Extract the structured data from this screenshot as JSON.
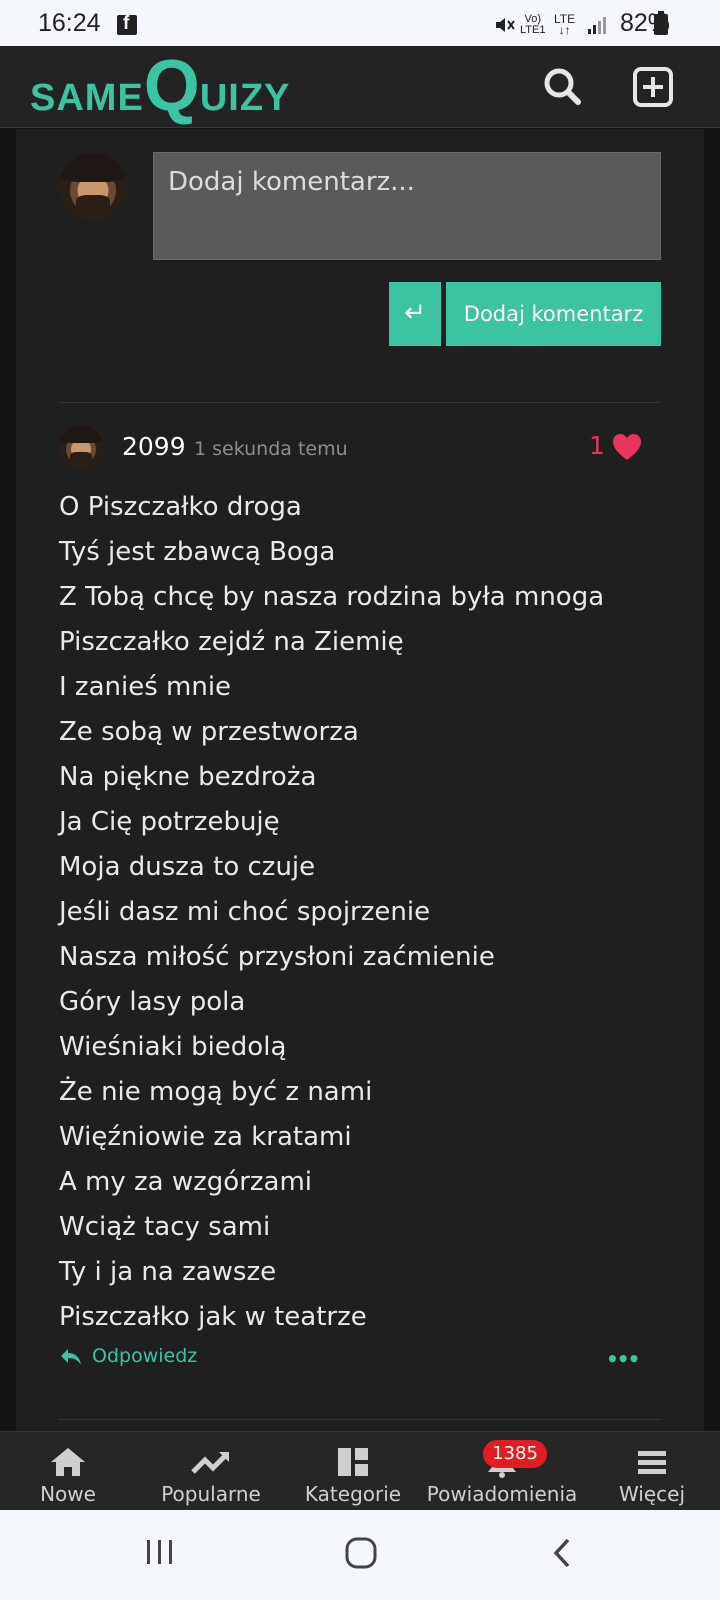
{
  "status_bar": {
    "time": "16:24",
    "battery": "82%",
    "network_top": "Vo)",
    "network_bottom": "LTE1",
    "lte": "LTE"
  },
  "header": {
    "logo_part1": "SAME",
    "logo_part2": "Q",
    "logo_part3": "UIZY",
    "search_icon": "search-icon",
    "add_icon": "plus-square-icon",
    "brand_color": "#3cc3a2"
  },
  "comment_form": {
    "placeholder": "Dodaj komentarz...",
    "enter_symbol": "↵",
    "submit_label": "Dodaj komentarz"
  },
  "comment": {
    "author": "2099",
    "time": "1 sekunda temu",
    "likes": "1",
    "like_color": "#e8355f",
    "lines": [
      "O Piszczałko droga",
      "Tyś jest zbawcą Boga",
      "Z Tobą chcę by nasza rodzina była mnoga",
      "Piszczałko zejdź na Ziemię",
      "I zanieś mnie",
      "Ze sobą w przestworza",
      "Na piękne bezdroża",
      "Ja Cię potrzebuję",
      "Moja dusza to czuje",
      "Jeśli dasz mi choć spojrzenie",
      "Nasza miłość przysłoni zaćmienie",
      "Góry lasy pola",
      "Wieśniaki biedolą",
      "Że nie mogą być z nami",
      "Więźniowie za kratami",
      "A my za wzgórzami",
      "Wciąż tacy sami",
      "Ty i ja na zawsze",
      "Piszczałko jak w teatrze"
    ],
    "reply_label": "Odpowiedz",
    "more_label": "•••"
  },
  "bottom_nav": {
    "items": [
      {
        "label": "Nowe",
        "icon": "home-icon"
      },
      {
        "label": "Popularne",
        "icon": "trending-icon"
      },
      {
        "label": "Kategorie",
        "icon": "categories-icon"
      },
      {
        "label": "Powiadomienia",
        "icon": "bell-icon"
      },
      {
        "label": "Więcej",
        "icon": "menu-icon"
      }
    ],
    "notifications_badge": "1385"
  }
}
